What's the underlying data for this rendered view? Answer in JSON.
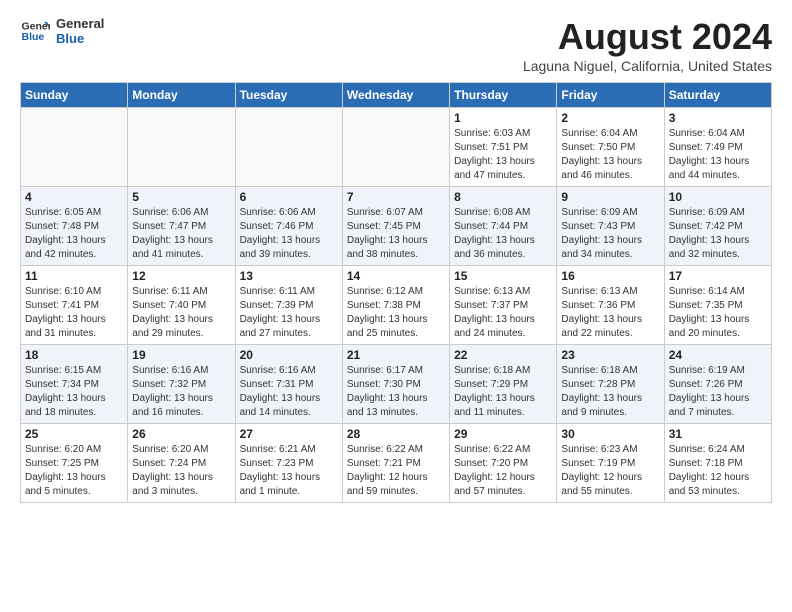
{
  "logo": {
    "line1": "General",
    "line2": "Blue"
  },
  "title": "August 2024",
  "location": "Laguna Niguel, California, United States",
  "days_of_week": [
    "Sunday",
    "Monday",
    "Tuesday",
    "Wednesday",
    "Thursday",
    "Friday",
    "Saturday"
  ],
  "weeks": [
    [
      {
        "day": "",
        "info": ""
      },
      {
        "day": "",
        "info": ""
      },
      {
        "day": "",
        "info": ""
      },
      {
        "day": "",
        "info": ""
      },
      {
        "day": "1",
        "info": "Sunrise: 6:03 AM\nSunset: 7:51 PM\nDaylight: 13 hours\nand 47 minutes."
      },
      {
        "day": "2",
        "info": "Sunrise: 6:04 AM\nSunset: 7:50 PM\nDaylight: 13 hours\nand 46 minutes."
      },
      {
        "day": "3",
        "info": "Sunrise: 6:04 AM\nSunset: 7:49 PM\nDaylight: 13 hours\nand 44 minutes."
      }
    ],
    [
      {
        "day": "4",
        "info": "Sunrise: 6:05 AM\nSunset: 7:48 PM\nDaylight: 13 hours\nand 42 minutes."
      },
      {
        "day": "5",
        "info": "Sunrise: 6:06 AM\nSunset: 7:47 PM\nDaylight: 13 hours\nand 41 minutes."
      },
      {
        "day": "6",
        "info": "Sunrise: 6:06 AM\nSunset: 7:46 PM\nDaylight: 13 hours\nand 39 minutes."
      },
      {
        "day": "7",
        "info": "Sunrise: 6:07 AM\nSunset: 7:45 PM\nDaylight: 13 hours\nand 38 minutes."
      },
      {
        "day": "8",
        "info": "Sunrise: 6:08 AM\nSunset: 7:44 PM\nDaylight: 13 hours\nand 36 minutes."
      },
      {
        "day": "9",
        "info": "Sunrise: 6:09 AM\nSunset: 7:43 PM\nDaylight: 13 hours\nand 34 minutes."
      },
      {
        "day": "10",
        "info": "Sunrise: 6:09 AM\nSunset: 7:42 PM\nDaylight: 13 hours\nand 32 minutes."
      }
    ],
    [
      {
        "day": "11",
        "info": "Sunrise: 6:10 AM\nSunset: 7:41 PM\nDaylight: 13 hours\nand 31 minutes."
      },
      {
        "day": "12",
        "info": "Sunrise: 6:11 AM\nSunset: 7:40 PM\nDaylight: 13 hours\nand 29 minutes."
      },
      {
        "day": "13",
        "info": "Sunrise: 6:11 AM\nSunset: 7:39 PM\nDaylight: 13 hours\nand 27 minutes."
      },
      {
        "day": "14",
        "info": "Sunrise: 6:12 AM\nSunset: 7:38 PM\nDaylight: 13 hours\nand 25 minutes."
      },
      {
        "day": "15",
        "info": "Sunrise: 6:13 AM\nSunset: 7:37 PM\nDaylight: 13 hours\nand 24 minutes."
      },
      {
        "day": "16",
        "info": "Sunrise: 6:13 AM\nSunset: 7:36 PM\nDaylight: 13 hours\nand 22 minutes."
      },
      {
        "day": "17",
        "info": "Sunrise: 6:14 AM\nSunset: 7:35 PM\nDaylight: 13 hours\nand 20 minutes."
      }
    ],
    [
      {
        "day": "18",
        "info": "Sunrise: 6:15 AM\nSunset: 7:34 PM\nDaylight: 13 hours\nand 18 minutes."
      },
      {
        "day": "19",
        "info": "Sunrise: 6:16 AM\nSunset: 7:32 PM\nDaylight: 13 hours\nand 16 minutes."
      },
      {
        "day": "20",
        "info": "Sunrise: 6:16 AM\nSunset: 7:31 PM\nDaylight: 13 hours\nand 14 minutes."
      },
      {
        "day": "21",
        "info": "Sunrise: 6:17 AM\nSunset: 7:30 PM\nDaylight: 13 hours\nand 13 minutes."
      },
      {
        "day": "22",
        "info": "Sunrise: 6:18 AM\nSunset: 7:29 PM\nDaylight: 13 hours\nand 11 minutes."
      },
      {
        "day": "23",
        "info": "Sunrise: 6:18 AM\nSunset: 7:28 PM\nDaylight: 13 hours\nand 9 minutes."
      },
      {
        "day": "24",
        "info": "Sunrise: 6:19 AM\nSunset: 7:26 PM\nDaylight: 13 hours\nand 7 minutes."
      }
    ],
    [
      {
        "day": "25",
        "info": "Sunrise: 6:20 AM\nSunset: 7:25 PM\nDaylight: 13 hours\nand 5 minutes."
      },
      {
        "day": "26",
        "info": "Sunrise: 6:20 AM\nSunset: 7:24 PM\nDaylight: 13 hours\nand 3 minutes."
      },
      {
        "day": "27",
        "info": "Sunrise: 6:21 AM\nSunset: 7:23 PM\nDaylight: 13 hours\nand 1 minute."
      },
      {
        "day": "28",
        "info": "Sunrise: 6:22 AM\nSunset: 7:21 PM\nDaylight: 12 hours\nand 59 minutes."
      },
      {
        "day": "29",
        "info": "Sunrise: 6:22 AM\nSunset: 7:20 PM\nDaylight: 12 hours\nand 57 minutes."
      },
      {
        "day": "30",
        "info": "Sunrise: 6:23 AM\nSunset: 7:19 PM\nDaylight: 12 hours\nand 55 minutes."
      },
      {
        "day": "31",
        "info": "Sunrise: 6:24 AM\nSunset: 7:18 PM\nDaylight: 12 hours\nand 53 minutes."
      }
    ]
  ]
}
